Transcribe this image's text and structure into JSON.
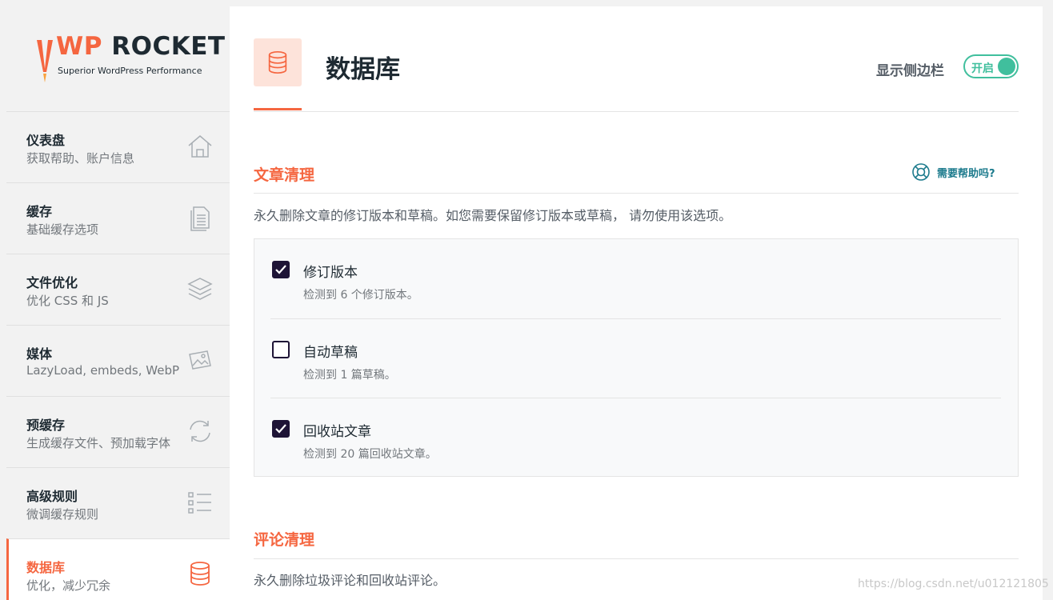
{
  "logo": {
    "brand_wp": "WP",
    "brand_rocket": "ROCKET",
    "tagline": "Superior WordPress Performance"
  },
  "sidebar": {
    "items": [
      {
        "title": "仪表盘",
        "subtitle": "获取帮助、账户信息",
        "icon": "home-icon"
      },
      {
        "title": "缓存",
        "subtitle": "基础缓存选项",
        "icon": "document-icon"
      },
      {
        "title": "文件优化",
        "subtitle": "优化 CSS 和 JS",
        "icon": "layers-icon"
      },
      {
        "title": "媒体",
        "subtitle": "LazyLoad, embeds, WebP",
        "icon": "images-icon"
      },
      {
        "title": "预缓存",
        "subtitle": "生成缓存文件、预加载字体",
        "icon": "refresh-icon"
      },
      {
        "title": "高级规则",
        "subtitle": "微调缓存规则",
        "icon": "checklist-icon"
      },
      {
        "title": "数据库",
        "subtitle": "优化，减少冗余",
        "icon": "database-icon",
        "active": true
      }
    ]
  },
  "header": {
    "title": "数据库",
    "icon": "database-icon",
    "sidebar_toggle_label": "显示侧边栏",
    "toggle_state": "开启"
  },
  "sections": {
    "posts": {
      "title": "文章清理",
      "help_label": "需要帮助吗?",
      "description": "永久删除文章的修订版本和草稿。如您需要保留修订版本或草稿， 请勿使用该选项。",
      "options": [
        {
          "label": "修订版本",
          "detail": "检测到 6 个修订版本。",
          "checked": true
        },
        {
          "label": "自动草稿",
          "detail": "检测到 1 篇草稿。",
          "checked": false
        },
        {
          "label": "回收站文章",
          "detail": "检测到 20 篇回收站文章。",
          "checked": true
        }
      ]
    },
    "comments": {
      "title": "评论清理",
      "description": "永久删除垃圾评论和回收站评论。"
    }
  },
  "watermark": "https://blog.csdn.net/u012121805",
  "colors": {
    "accent": "#f56640",
    "toggle_on": "#40bf9d",
    "checkbox": "#1e1436",
    "help_link": "#1b7a8c"
  }
}
